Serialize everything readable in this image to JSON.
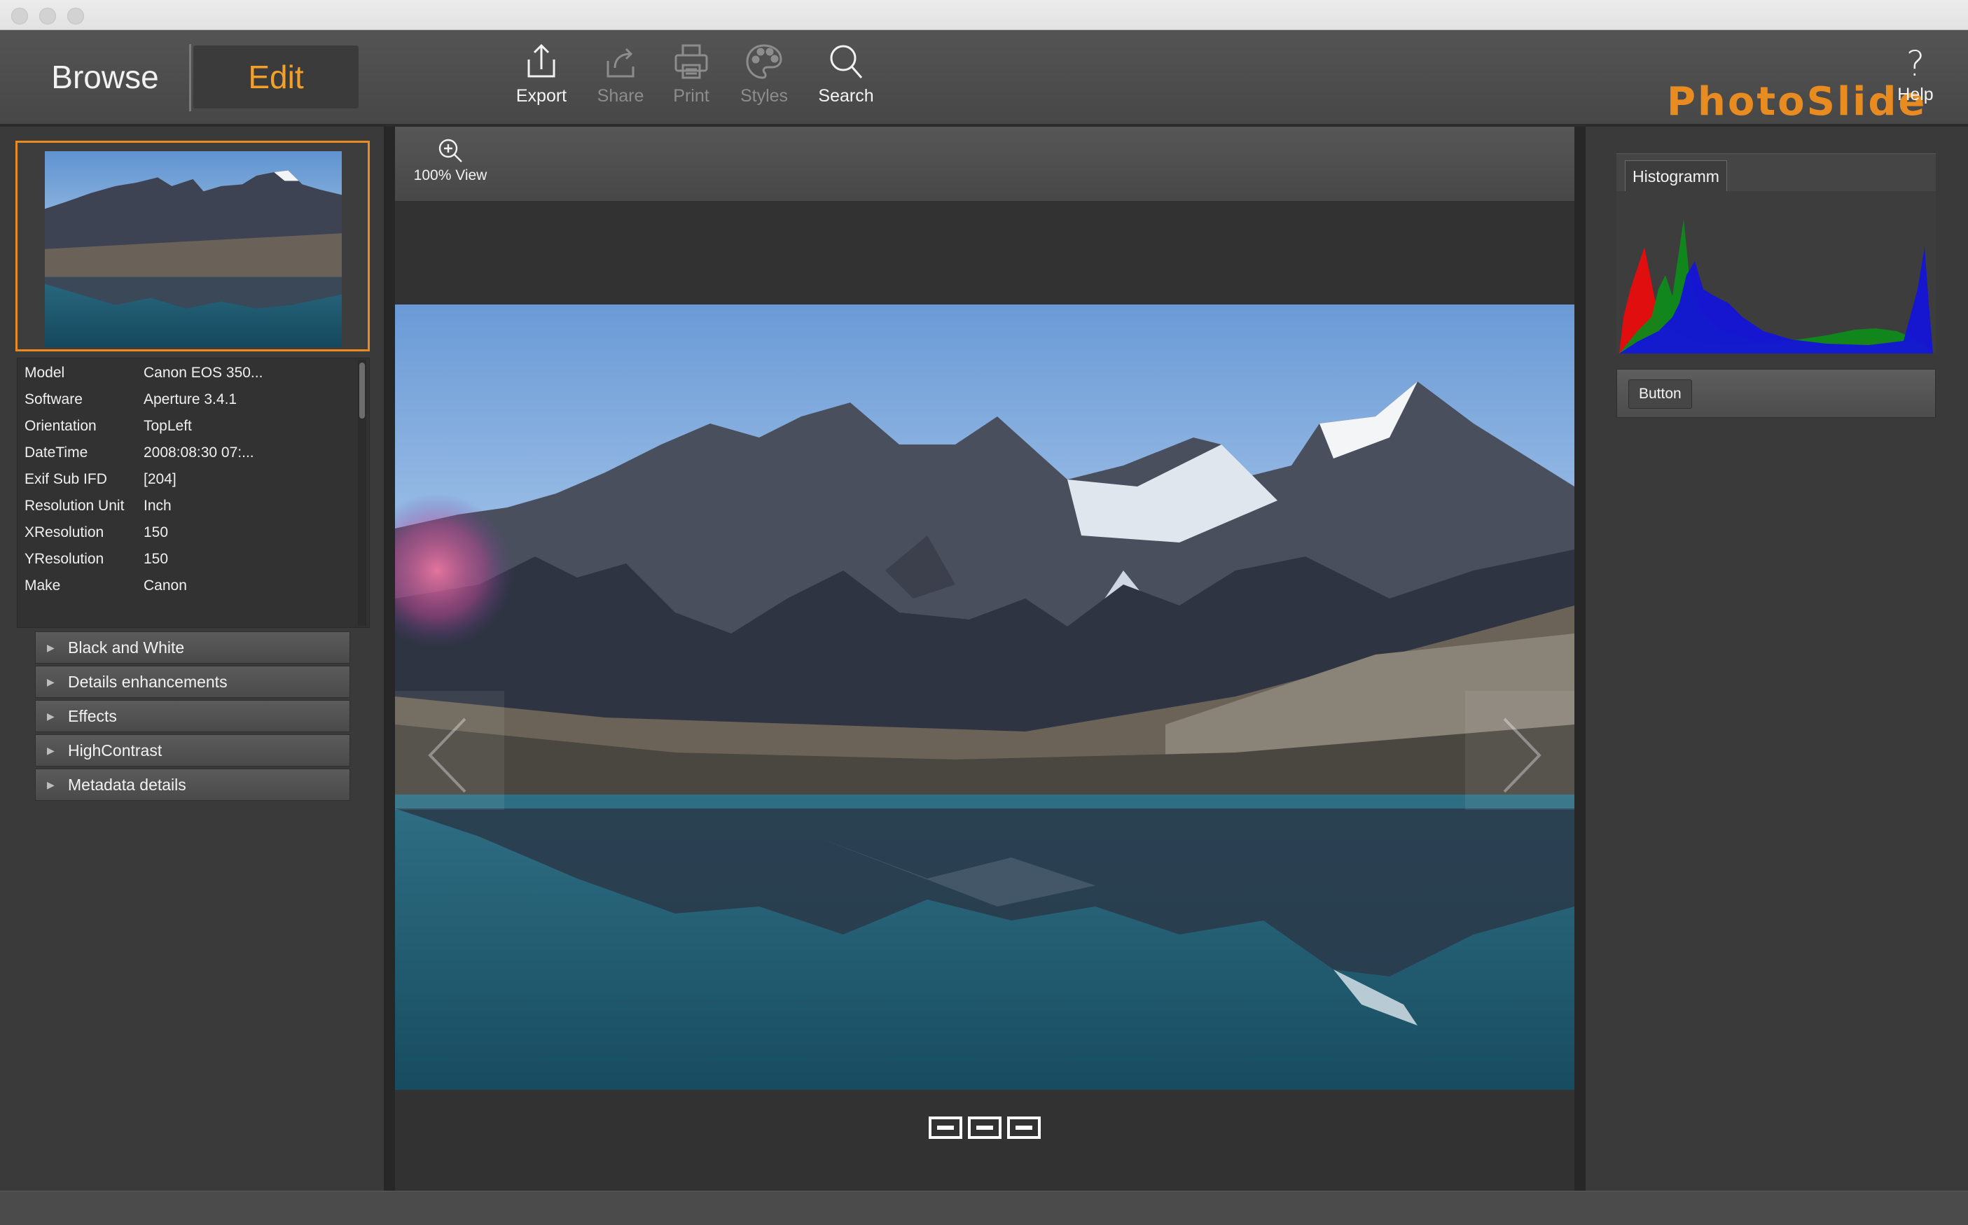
{
  "toolbar": {
    "browse_label": "Browse",
    "edit_label": "Edit",
    "tools": {
      "export": {
        "label": "Export",
        "icon": "export-icon"
      },
      "share": {
        "label": "Share",
        "icon": "share-icon"
      },
      "print": {
        "label": "Print",
        "icon": "print-icon"
      },
      "styles": {
        "label": "Styles",
        "icon": "palette-icon"
      },
      "search": {
        "label": "Search",
        "icon": "search-icon"
      }
    },
    "brand": "PhotoSlide",
    "help_label": "Help",
    "help_icon": "?"
  },
  "colors": {
    "accent": "#e88b20",
    "edit_text": "#f3a02b",
    "background": "#2b2b2b",
    "toolbar": "#4e4e4e"
  },
  "metadata": {
    "rows": [
      {
        "key": "Model",
        "value": "Canon EOS 350..."
      },
      {
        "key": "Software",
        "value": "Aperture 3.4.1"
      },
      {
        "key": "Orientation",
        "value": "TopLeft"
      },
      {
        "key": "DateTime",
        "value": "2008:08:30 07:..."
      },
      {
        "key": "Exif Sub IFD",
        "value": "[204]"
      },
      {
        "key": "Resolution Unit",
        "value": "Inch"
      },
      {
        "key": "XResolution",
        "value": "150"
      },
      {
        "key": "YResolution",
        "value": "150"
      },
      {
        "key": "Make",
        "value": "Canon"
      }
    ]
  },
  "adjustments": [
    "Black and White",
    "Details enhancements",
    "Effects",
    "HighContrast",
    "Metadata details"
  ],
  "viewer": {
    "zoom_label": "100% View",
    "page_count": 3
  },
  "right_panel": {
    "histogram_tab": "Histogramm",
    "button_label": "Button"
  }
}
